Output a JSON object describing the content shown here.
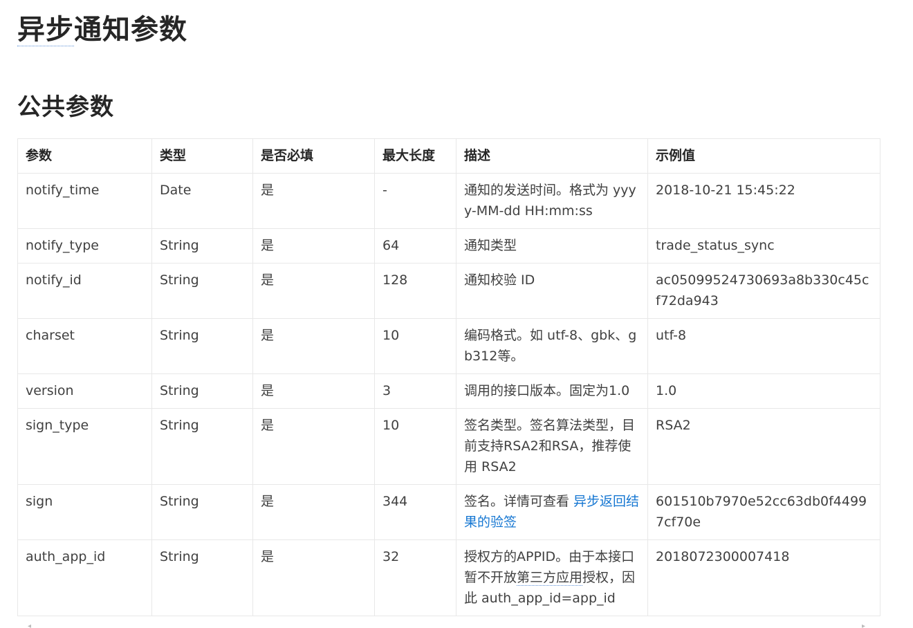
{
  "heading": {
    "prefix": "异步",
    "rest": "通知参数"
  },
  "subheading": "公共参数",
  "table": {
    "headers": [
      "参数",
      "类型",
      "是否必填",
      "最大长度",
      "描述",
      "示例值"
    ],
    "rows": [
      {
        "param": "notify_time",
        "type": "Date",
        "required": "是",
        "max_len": "-",
        "desc": "通知的发送时间。格式为 yyyy-MM-dd HH:mm:ss",
        "example": "2018-10-21 15:45:22"
      },
      {
        "param": "notify_type",
        "type": "String",
        "required": "是",
        "max_len": "64",
        "desc": "通知类型",
        "example": "trade_status_sync"
      },
      {
        "param": "notify_id",
        "type": "String",
        "required": "是",
        "max_len": "128",
        "desc": "通知校验 ID",
        "example": "ac05099524730693a8b330c45cf72da943"
      },
      {
        "param": "charset",
        "type": "String",
        "required": "是",
        "max_len": "10",
        "desc": "编码格式。如 utf-8、gbk、gb312等。",
        "example": "utf-8"
      },
      {
        "param": "version",
        "type": "String",
        "required": "是",
        "max_len": "3",
        "desc": "调用的接口版本。固定为1.0",
        "example": "1.0"
      },
      {
        "param": "sign_type",
        "type": "String",
        "required": "是",
        "max_len": "10",
        "desc": "签名类型。签名算法类型，目前支持RSA2和RSA，推荐使用 RSA2",
        "example": "RSA2"
      },
      {
        "param": "sign",
        "type": "String",
        "required": "是",
        "max_len": "344",
        "desc_prefix": "签名。详情可查看 ",
        "desc_link": "异步返回结果的验签",
        "example": "601510b7970e52cc63db0f44997cf70e"
      },
      {
        "param": "auth_app_id",
        "type": "String",
        "required": "是",
        "max_len": "32",
        "desc_a": "授权方的APPID。由于本接口暂不开放",
        "desc_u": "第三方应用",
        "desc_b": "授权，因此 auth_app_id=app_id",
        "example": "2018072300007418"
      }
    ]
  },
  "colors": {
    "link": "#1677d2",
    "border": "#e8e8e8",
    "heading": "#262626"
  }
}
